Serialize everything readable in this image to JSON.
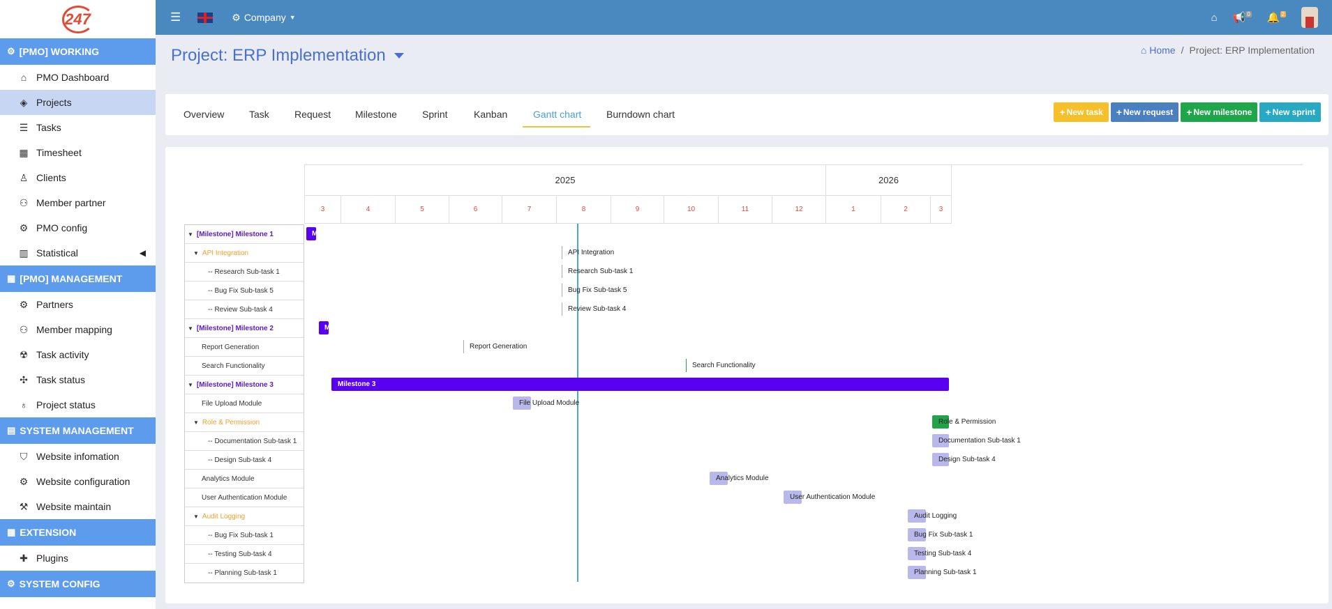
{
  "sidebar": {
    "sections": [
      {
        "title": "[PMO] WORKING",
        "items": [
          "PMO Dashboard",
          "Projects",
          "Tasks",
          "Timesheet",
          "Clients",
          "Member partner",
          "PMO config",
          "Statistical"
        ]
      },
      {
        "title": "[PMO] MANAGEMENT",
        "items": [
          "Partners",
          "Member mapping",
          "Task activity",
          "Task status",
          "Project status"
        ]
      },
      {
        "title": "SYSTEM MANAGEMENT",
        "items": [
          "Website infomation",
          "Website configuration",
          "Website maintain"
        ]
      },
      {
        "title": "EXTENSION",
        "items": [
          "Plugins"
        ]
      },
      {
        "title": "SYSTEM CONFIG",
        "items": []
      }
    ],
    "logo_text": "247"
  },
  "topbar": {
    "company_label": "Company",
    "announce_badge": "0",
    "bell_badge": "2"
  },
  "header": {
    "title": "Project: ERP Implementation",
    "breadcrumb_home": "Home",
    "breadcrumb_current": "Project: ERP Implementation"
  },
  "tabs": [
    "Overview",
    "Task",
    "Request",
    "Milestone",
    "Sprint",
    "Kanban",
    "Gantt chart",
    "Burndown chart"
  ],
  "buttons": {
    "new_task": "New task",
    "new_request": "New request",
    "new_milestone": "New milestone",
    "new_sprint": "New sprint"
  },
  "gantt": {
    "years": [
      "2025",
      "2026"
    ],
    "months": [
      "3",
      "4",
      "5",
      "6",
      "7",
      "8",
      "9",
      "10",
      "11",
      "12",
      "1",
      "2",
      "3"
    ],
    "rows": [
      {
        "label": "[Milestone] Milestone 1",
        "kind": "ms"
      },
      {
        "label": "API Integration",
        "kind": "grp"
      },
      {
        "label": "-- Research Sub-task 1",
        "kind": "sub"
      },
      {
        "label": "-- Bug Fix Sub-task 5",
        "kind": "sub"
      },
      {
        "label": "-- Review Sub-task 4",
        "kind": "sub"
      },
      {
        "label": "[Milestone] Milestone 2",
        "kind": "ms"
      },
      {
        "label": "Report Generation",
        "kind": "plain"
      },
      {
        "label": "Search Functionality",
        "kind": "plain"
      },
      {
        "label": "[Milestone] Milestone 3",
        "kind": "ms"
      },
      {
        "label": "File Upload Module",
        "kind": "plain"
      },
      {
        "label": "Role & Permission",
        "kind": "grp"
      },
      {
        "label": "-- Documentation Sub-task 1",
        "kind": "sub"
      },
      {
        "label": "-- Design Sub-task 4",
        "kind": "sub"
      },
      {
        "label": "Analytics Module",
        "kind": "plain"
      },
      {
        "label": "User Authentication Module",
        "kind": "plain"
      },
      {
        "label": "Audit Logging",
        "kind": "grp"
      },
      {
        "label": "-- Bug Fix Sub-task 1",
        "kind": "sub"
      },
      {
        "label": "-- Testing Sub-task 4",
        "kind": "sub"
      },
      {
        "label": "-- Planning Sub-task 1",
        "kind": "sub"
      }
    ],
    "bar_labels": {
      "m1": "M",
      "api": "API Integration",
      "research": "Research Sub-task 1",
      "bugfix5": "Bug Fix Sub-task 5",
      "review4": "Review Sub-task 4",
      "m2": "M",
      "report": "Report Generation",
      "search": "Search Functionality",
      "m3": "Milestone 3",
      "upload": "File Upload Module",
      "role": "Role & Permission",
      "doc1": "Documentation Sub-task 1",
      "design4": "Design Sub-task 4",
      "analytics": "Analytics Module",
      "auth": "User Authentication Module",
      "audit": "Audit Logging",
      "bugfix1": "Bug Fix Sub-task 1",
      "testing4": "Testing Sub-task 4",
      "planning1": "Planning Sub-task 1"
    },
    "colors": {
      "milestone": "#5a00f0",
      "task": "#b9b8ec",
      "done": "#22a34a"
    }
  }
}
